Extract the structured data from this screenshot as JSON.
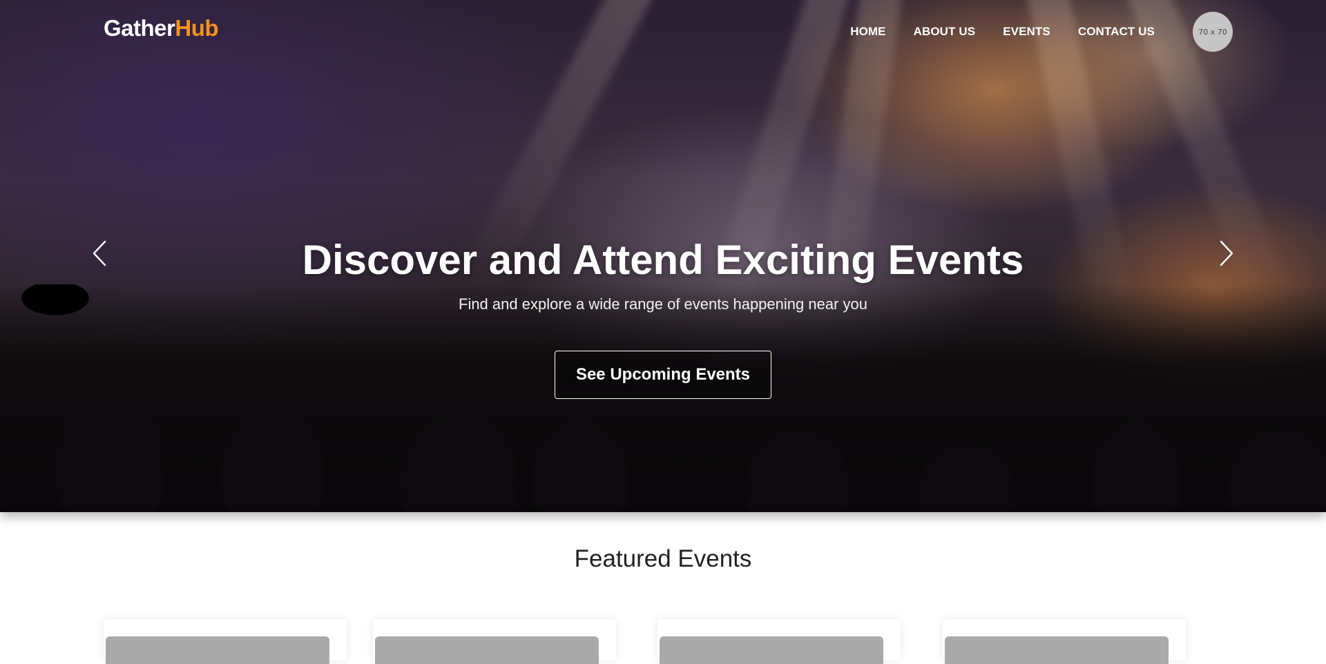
{
  "brand": {
    "name_part1": "Gather",
    "name_part2": "Hub",
    "accent_color": "#f7931e"
  },
  "nav": {
    "items": [
      {
        "label": "HOME"
      },
      {
        "label": "ABOUT US"
      },
      {
        "label": "EVENTS"
      },
      {
        "label": "CONTACT US"
      }
    ],
    "avatar_placeholder": "70 x 70"
  },
  "hero": {
    "title": "Discover and Attend Exciting Events",
    "subtitle": "Find and explore a wide range of events happening near you",
    "cta_label": "See Upcoming Events",
    "prev_icon": "chevron-left-icon",
    "next_icon": "chevron-right-icon"
  },
  "featured": {
    "title": "Featured Events",
    "cards": [
      {},
      {},
      {},
      {}
    ]
  }
}
